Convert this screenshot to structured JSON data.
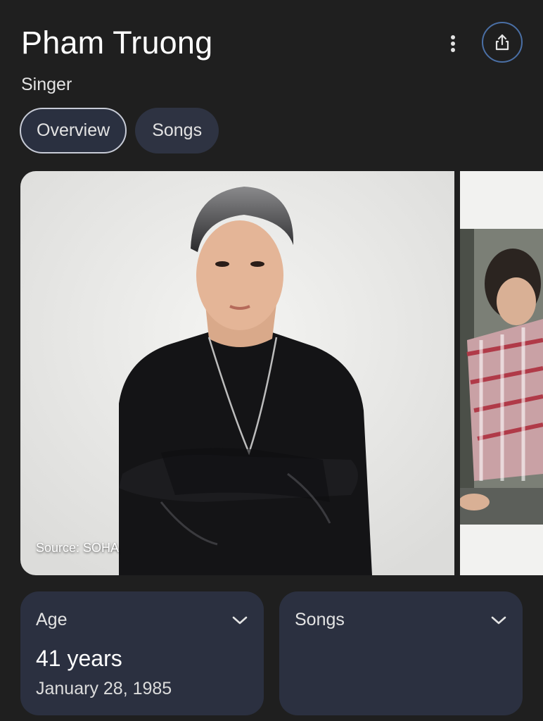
{
  "header": {
    "title": "Pham Truong",
    "subtitle": "Singer"
  },
  "actions": {
    "more_icon": "more-vertical-icon",
    "share_icon": "share-icon",
    "accent_color": "#4a6fa5"
  },
  "tabs": [
    {
      "label": "Overview",
      "active": true
    },
    {
      "label": "Songs",
      "active": false
    }
  ],
  "gallery": {
    "source_label": "Source: SOHA"
  },
  "cards": {
    "age": {
      "title": "Age",
      "value": "41 years",
      "detail": "January 28, 1985"
    },
    "songs": {
      "title": "Songs"
    }
  },
  "colors": {
    "background": "#1f1f1f",
    "card": "#2b3040"
  }
}
